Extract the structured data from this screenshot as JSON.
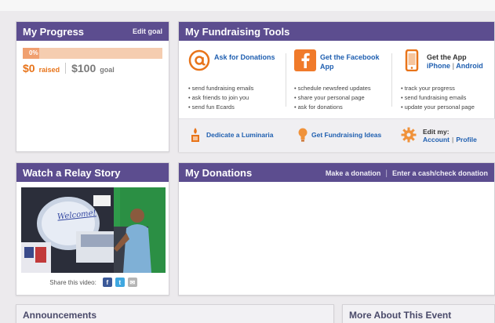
{
  "progress": {
    "title": "My Progress",
    "edit_goal": "Edit goal",
    "percent_label": "0%",
    "percent": 0,
    "raised_amount": "$0",
    "raised_label": "raised",
    "goal_amount": "$100",
    "goal_label": "goal"
  },
  "tools": {
    "title": "My Fundraising Tools",
    "columns": [
      {
        "title": "Ask for Donations",
        "icon": "at-sign-icon",
        "items": [
          "send fundraising emails",
          "ask friends to join you",
          "send fun Ecards"
        ]
      },
      {
        "title": "Get the Facebook App",
        "icon": "facebook-icon",
        "items": [
          "schedule newsfeed updates",
          "share your personal page",
          "ask for donations"
        ]
      },
      {
        "title": "Get the App",
        "icon": "phone-icon",
        "links": [
          "iPhone",
          "Android"
        ],
        "items": [
          "track your progress",
          "send fundraising emails",
          "update your personal page"
        ]
      }
    ],
    "bottom": {
      "luminaria": "Dedicate a Luminaria",
      "ideas": "Get Fundraising Ideas",
      "edit_my": "Edit my:",
      "account": "Account",
      "profile": "Profile"
    }
  },
  "story": {
    "title": "Watch a Relay Story",
    "video_welcome": "Welcome!",
    "share_label": "Share this video:"
  },
  "donations": {
    "title": "My Donations",
    "make_donation": "Make a donation",
    "enter_cash": "Enter a cash/check donation"
  },
  "announcements": {
    "title": "Announcements"
  },
  "more": {
    "title": "More About This Event"
  },
  "colors": {
    "header": "#5c4d8f",
    "accent_orange": "#e8741a",
    "link_blue": "#1f5fb0",
    "facebook": "#3b5998"
  }
}
